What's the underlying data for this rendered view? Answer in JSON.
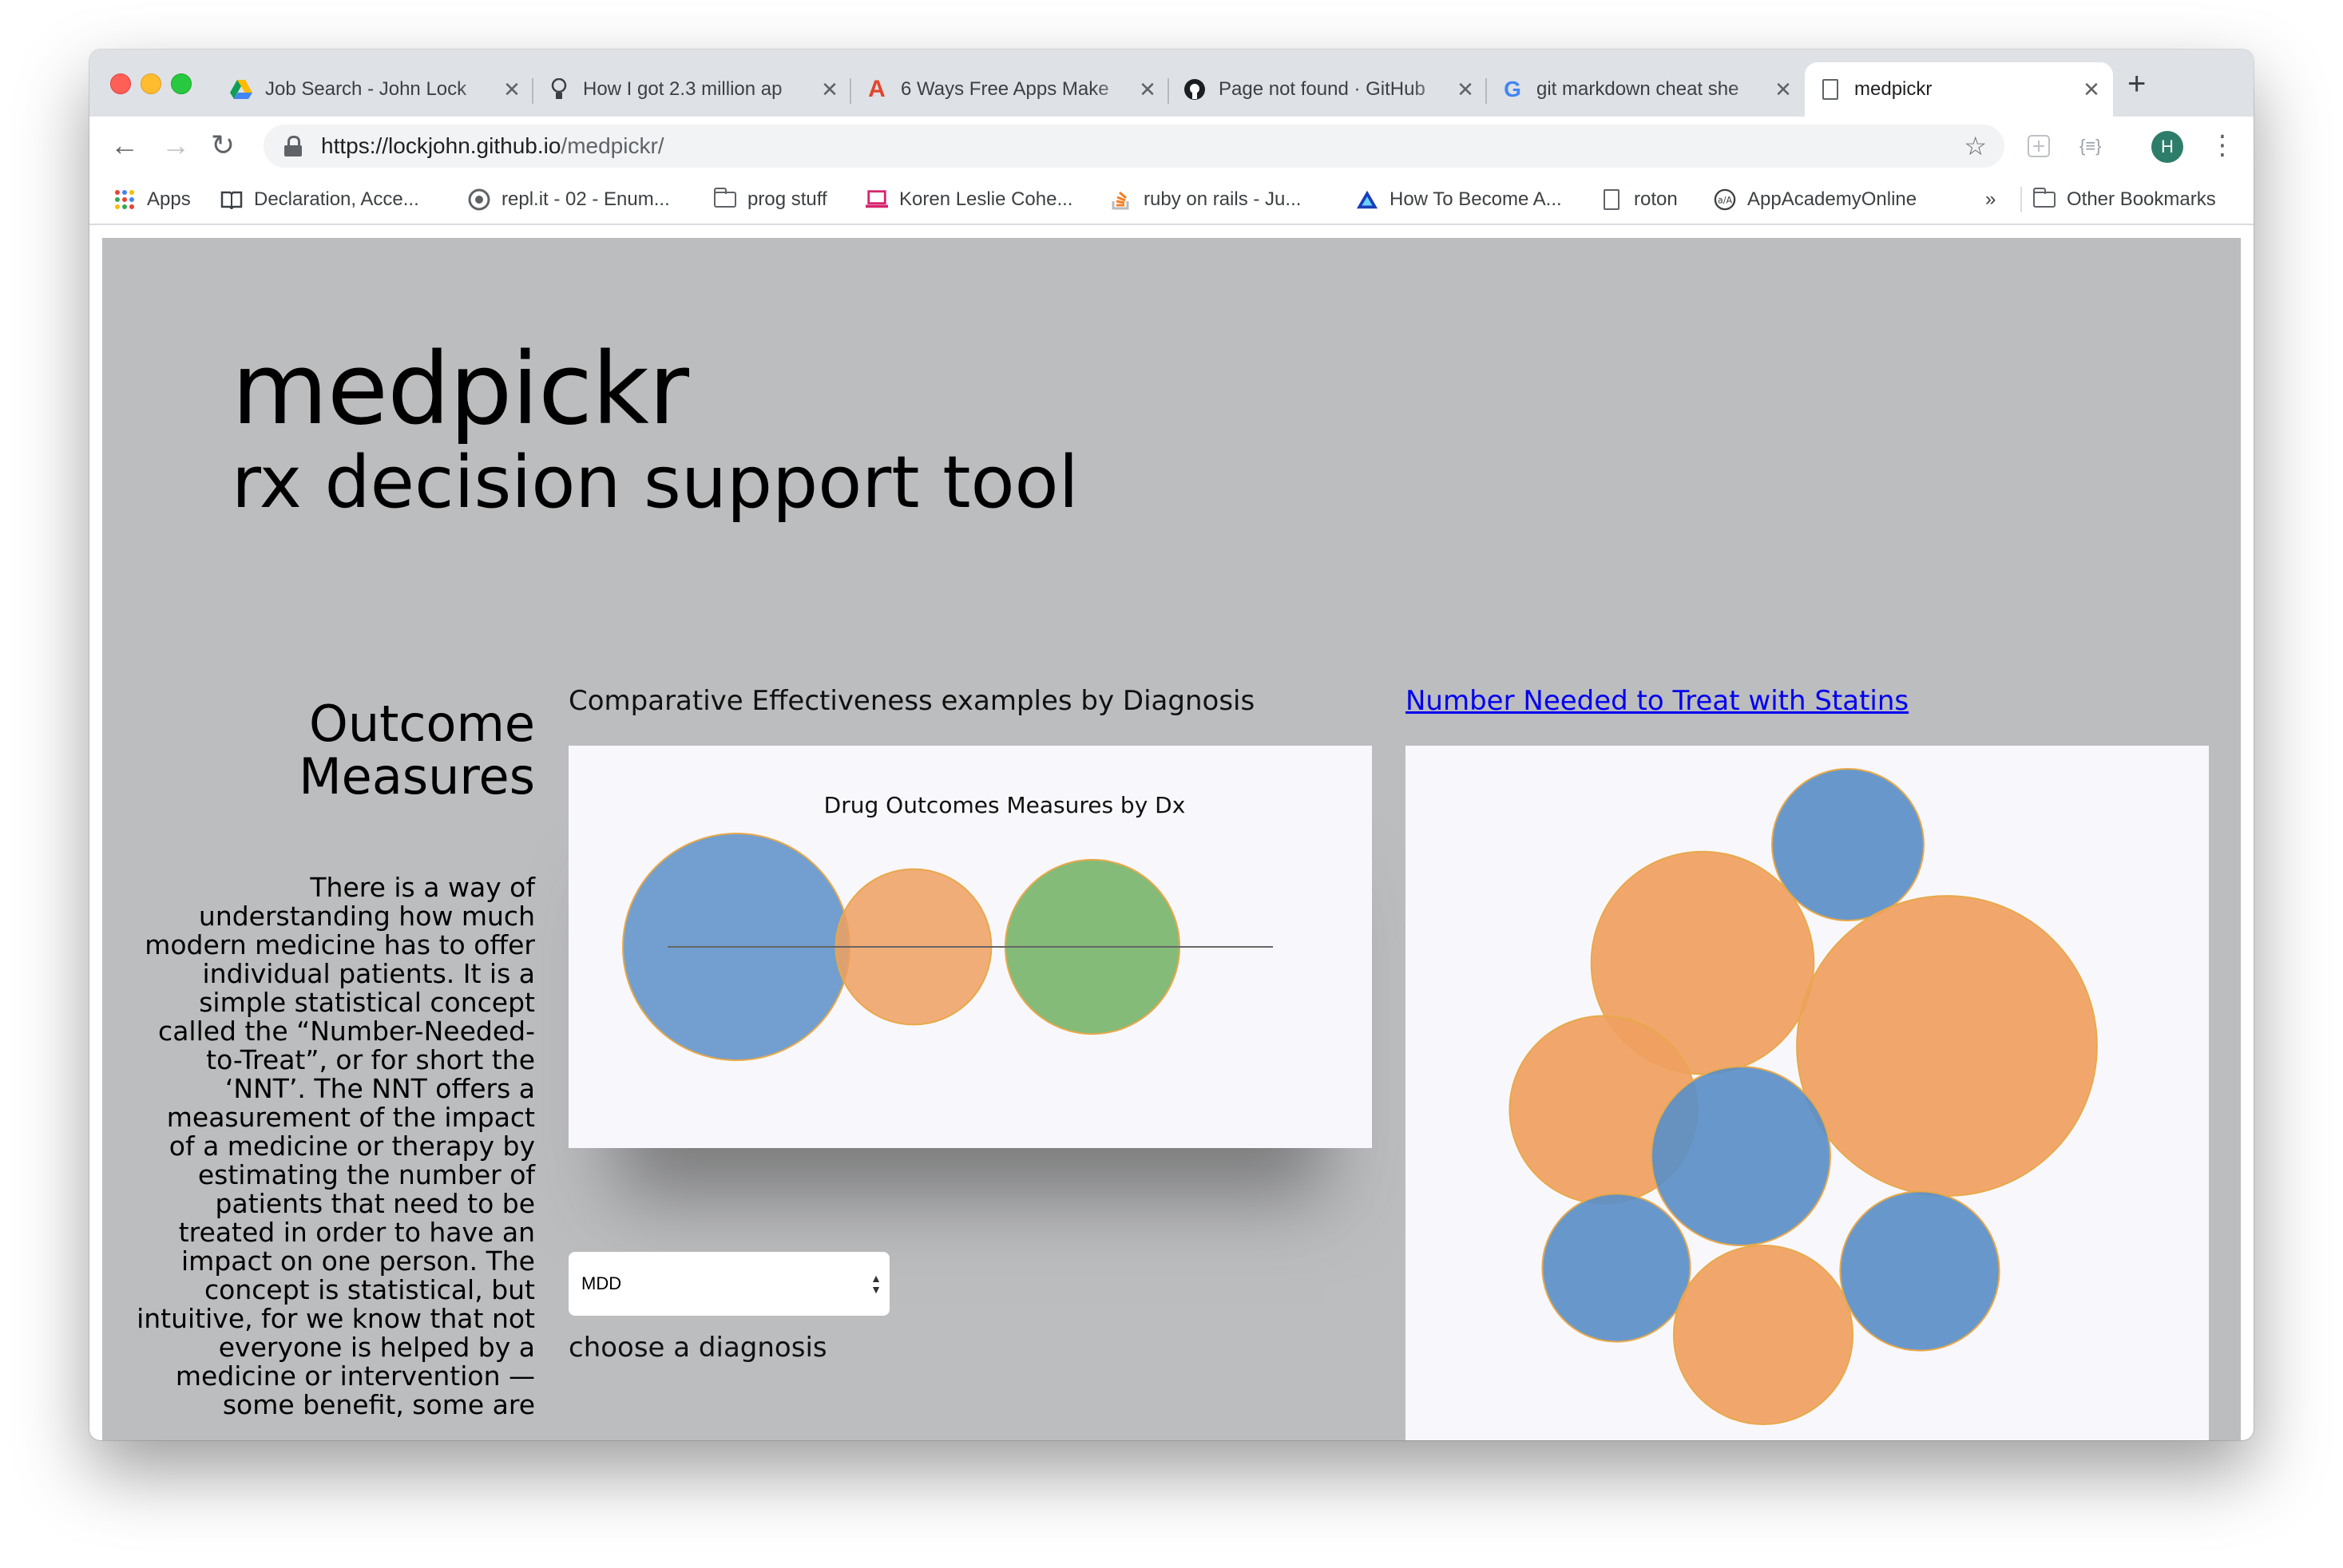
{
  "browser": {
    "tabs": [
      {
        "title": "Job Search - John Lock",
        "icon": "google-drive-icon",
        "active": false
      },
      {
        "title": "How I got 2.3 million ap",
        "icon": "lightbulb-icon",
        "active": false
      },
      {
        "title": "6 Ways Free Apps Make",
        "icon": "letter-a-icon",
        "active": false
      },
      {
        "title": "Page not found · GitHub",
        "icon": "github-icon",
        "active": false
      },
      {
        "title": "git markdown cheat she",
        "icon": "google-icon",
        "active": false
      },
      {
        "title": "medpickr",
        "icon": "document-icon",
        "active": true
      }
    ],
    "url": {
      "host": "https://lockjohn.github.io",
      "path": "/medpickr/"
    },
    "avatar_letter": "H",
    "extension_label": "{≡}",
    "bookmarks": [
      {
        "label": "Apps",
        "icon": "apps-grid-icon"
      },
      {
        "label": "Declaration, Acce...",
        "icon": "book-icon"
      },
      {
        "label": "repl.it - 02 - Enum...",
        "icon": "replit-icon"
      },
      {
        "label": "prog stuff",
        "icon": "folder-icon"
      },
      {
        "label": "Koren Leslie Cohe...",
        "icon": "laptop-icon"
      },
      {
        "label": "ruby on rails - Ju...",
        "icon": "stackoverflow-icon"
      },
      {
        "label": "How To Become A...",
        "icon": "triangle-icon"
      },
      {
        "label": "roton",
        "icon": "document-icon"
      },
      {
        "label": "AppAcademyOnline",
        "icon": "appacademy-icon"
      }
    ],
    "overflow_label": "»",
    "other_bookmarks_label": "Other Bookmarks",
    "colors": {
      "tabstrip": "#dee1e6",
      "accent": "#1a73e8"
    }
  },
  "page": {
    "title": "medpickr",
    "subtitle": "rx decision support tool",
    "outcome_heading": "Outcome Measures",
    "paragraph": "There is a way of understanding how much modern medicine has to offer individual patients. It is a simple statistical concept called the “Number-Needed-to-Treat”, or for short the ‘NNT’. The NNT offers a measurement of the impact of a medicine or therapy by estimating the number of patients that need to be treated in order to have an impact on one person. The concept is statistical, but intuitive, for we know that not everyone is helped by a medicine or intervention — some benefit, some are",
    "chart_heading": "Comparative Effectiveness examples by Diagnosis",
    "statin_link": "Number Needed to Treat with Statins",
    "select_value": "MDD",
    "select_caption": "choose a diagnosis",
    "colors": {
      "background": "#bcbdbf",
      "link": "#0000ee"
    }
  },
  "chart_data": [
    {
      "type": "bubble",
      "title": "Drug Outcomes Measures by Dx",
      "series": [
        {
          "value": 100,
          "color": "#5b8fc7"
        },
        {
          "value": 47,
          "color": "#f0a060"
        },
        {
          "value": 59,
          "color": "#70b060"
        }
      ]
    },
    {
      "type": "bubble",
      "title": "",
      "series": [
        {
          "value": 100,
          "color": "#5b8fc7"
        },
        {
          "value": 215,
          "color": "#f0a060"
        },
        {
          "value": 391,
          "color": "#f0a060"
        },
        {
          "value": 153,
          "color": "#f0a060"
        },
        {
          "value": 139,
          "color": "#5b8fc7"
        },
        {
          "value": 95,
          "color": "#5b8fc7"
        },
        {
          "value": 110,
          "color": "#5b8fc7"
        },
        {
          "value": 139,
          "color": "#f0a060"
        }
      ]
    }
  ]
}
